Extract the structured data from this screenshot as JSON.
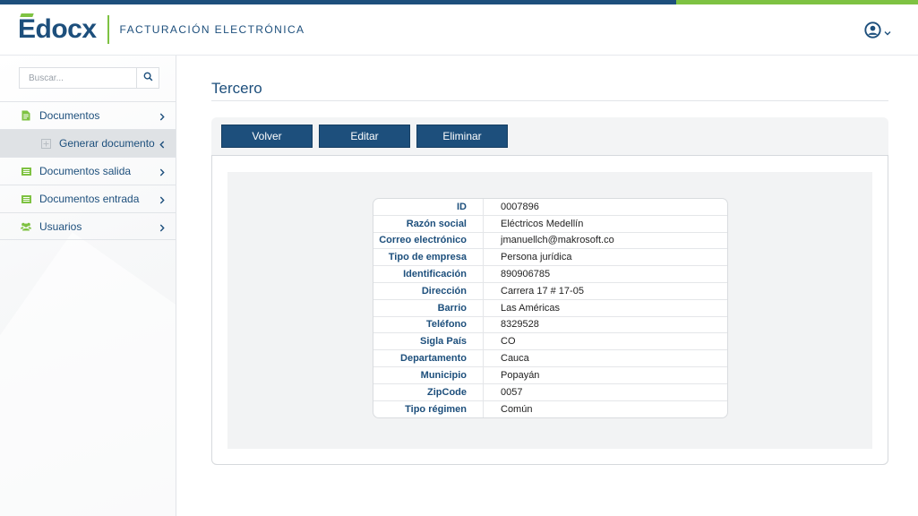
{
  "header": {
    "logo_text": "Edocx",
    "app_title": "FACTURACIÓN ELECTRÓNICA",
    "user_icon": "user-circle-icon"
  },
  "colors": {
    "brand_blue": "#1d4f7c",
    "brand_green": "#7ec242"
  },
  "sidebar": {
    "search": {
      "placeholder": "Buscar..."
    },
    "items": [
      {
        "label": "Documentos",
        "icon": "document-icon"
      },
      {
        "label": "Generar documento",
        "icon": "plus-square-icon"
      },
      {
        "label": "Documentos salida",
        "icon": "list-icon"
      },
      {
        "label": "Documentos entrada",
        "icon": "list-icon"
      },
      {
        "label": "Usuarios",
        "icon": "users-icon"
      }
    ]
  },
  "main": {
    "title": "Tercero",
    "buttons": {
      "back": "Volver",
      "edit": "Editar",
      "delete": "Eliminar"
    },
    "details": [
      {
        "label": "ID",
        "value": "0007896"
      },
      {
        "label": "Razón social",
        "value": "Eléctricos Medellín"
      },
      {
        "label": "Correo electrónico",
        "value": "jmanuellch@makrosoft.co"
      },
      {
        "label": "Tipo de empresa",
        "value": "Persona jurídica"
      },
      {
        "label": "Identificación",
        "value": "890906785"
      },
      {
        "label": "Dirección",
        "value": "Carrera 17 # 17-05"
      },
      {
        "label": "Barrio",
        "value": "Las Américas"
      },
      {
        "label": "Teléfono",
        "value": "8329528"
      },
      {
        "label": "Sigla País",
        "value": "CO"
      },
      {
        "label": "Departamento",
        "value": "Cauca"
      },
      {
        "label": "Municipio",
        "value": "Popayán"
      },
      {
        "label": "ZipCode",
        "value": "0057"
      },
      {
        "label": "Tipo régimen",
        "value": "Común"
      }
    ]
  }
}
